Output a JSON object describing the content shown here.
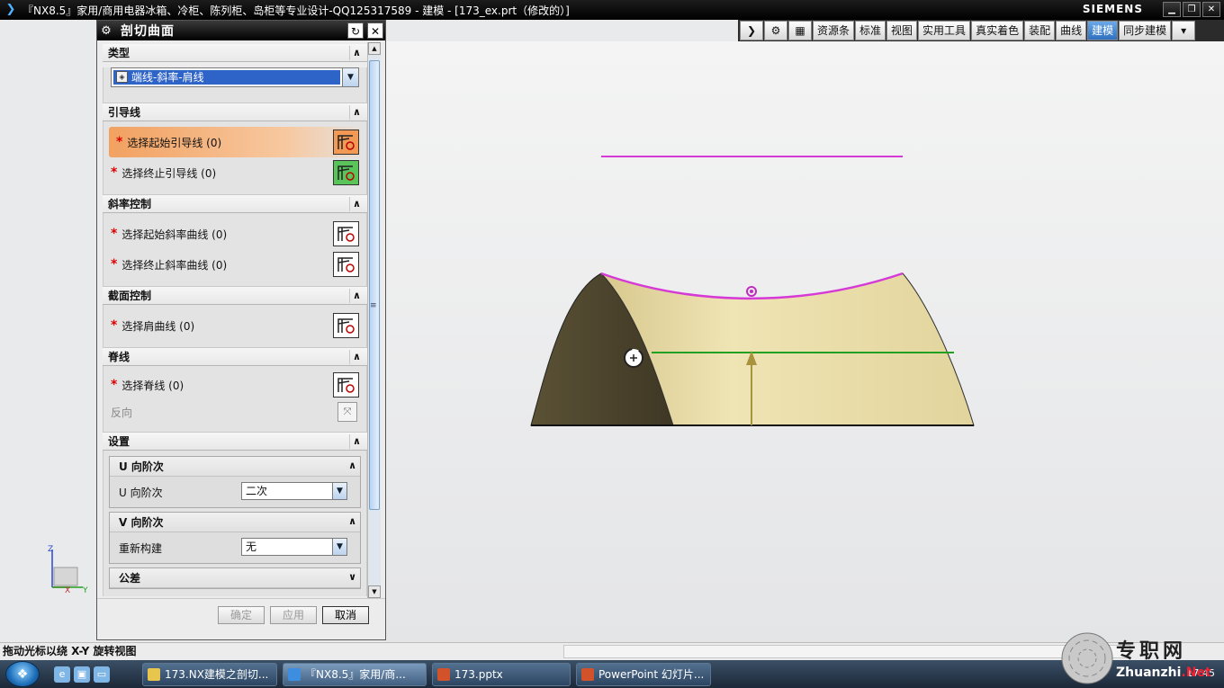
{
  "window": {
    "title": "『NX8.5』家用/商用电器冰箱、冷柜、陈列柜、岛柜等专业设计-QQ125317589 - 建模 - [173_ex.prt（修改的）]",
    "brand": "SIEMENS",
    "controls": {
      "minimize": "▁",
      "restore": "❐",
      "close": "✕"
    }
  },
  "toolbar": {
    "items": [
      "资源条",
      "标准",
      "视图",
      "实用工具",
      "真实着色",
      "装配",
      "曲线",
      "建模",
      "同步建模"
    ],
    "active": "建模",
    "more": "▾"
  },
  "dialog": {
    "title": "剖切曲面",
    "type_group": {
      "label": "类型",
      "selected": "端线-斜率-肩线"
    },
    "guide_group": {
      "label": "引导线",
      "start": "选择起始引导线 (0)",
      "end": "选择终止引导线 (0)"
    },
    "slope_group": {
      "label": "斜率控制",
      "start": "选择起始斜率曲线 (0)",
      "end": "选择终止斜率曲线 (0)"
    },
    "section_group": {
      "label": "截面控制",
      "shoulder": "选择肩曲线 (0)"
    },
    "spine_group": {
      "label": "脊线",
      "spine": "选择脊线 (0)",
      "reverse": "反向"
    },
    "settings_group": {
      "label": "设置",
      "u_degree": {
        "header": "U 向阶次",
        "label": "U 向阶次",
        "value": "二次"
      },
      "v_degree": {
        "header": "V 向阶次",
        "label": "重新构建",
        "value": "无"
      },
      "tolerance": {
        "header": "公差"
      }
    },
    "buttons": {
      "ok": "确定",
      "apply": "应用",
      "cancel": "取消"
    }
  },
  "triad": {
    "z": "Z",
    "x": "X",
    "y": "Y"
  },
  "status": {
    "message": "拖动光标以绕 X-Y 旋转视图"
  },
  "taskbar": {
    "tasks": [
      "173.NX建模之剖切...",
      "『NX8.5』家用/商...",
      "173.pptx",
      "PowerPoint 幻灯片..."
    ],
    "clock": "17:45"
  },
  "watermark": {
    "main": "专职网",
    "sub_prefix": "Zhuanzhi",
    "sub_suffix": ".Net"
  },
  "colors": {
    "surface": "#e7dba5",
    "surface_dark": "#4f4630",
    "guide_curve": "#d63ad6",
    "section_line": "#22a022",
    "active_row": "#f2a160",
    "select_blue": "#2e63c8"
  }
}
